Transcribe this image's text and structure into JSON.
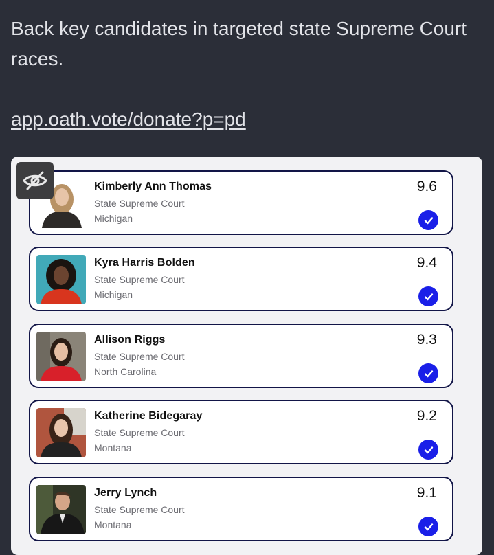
{
  "post": {
    "text": "Back key candidates in targeted state Supreme Court races.",
    "link": "app.oath.vote/donate?p=pd"
  },
  "icons": {
    "hide": "eye-slash-icon",
    "check": "check-circle-icon"
  },
  "colors": {
    "background": "#2b2e38",
    "card_border": "#121547",
    "check": "#1a1fe8"
  },
  "candidates": [
    {
      "name": "Kimberly Ann Thomas",
      "office": "State Supreme Court",
      "state": "Michigan",
      "score": "9.6"
    },
    {
      "name": "Kyra Harris Bolden",
      "office": "State Supreme Court",
      "state": "Michigan",
      "score": "9.4"
    },
    {
      "name": "Allison Riggs",
      "office": "State Supreme Court",
      "state": "North Carolina",
      "score": "9.3"
    },
    {
      "name": "Katherine Bidegaray",
      "office": "State Supreme Court",
      "state": "Montana",
      "score": "9.2"
    },
    {
      "name": "Jerry Lynch",
      "office": "State Supreme Court",
      "state": "Montana",
      "score": "9.1"
    }
  ]
}
